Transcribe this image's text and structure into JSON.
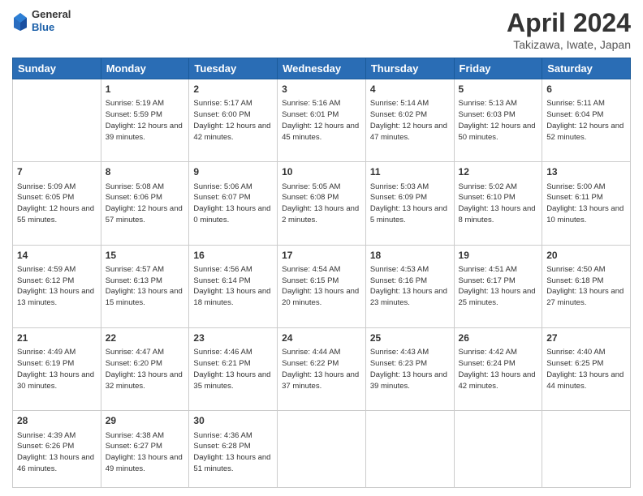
{
  "header": {
    "logo": {
      "line1": "General",
      "line2": "Blue"
    },
    "title": "April 2024",
    "location": "Takizawa, Iwate, Japan"
  },
  "weekdays": [
    "Sunday",
    "Monday",
    "Tuesday",
    "Wednesday",
    "Thursday",
    "Friday",
    "Saturday"
  ],
  "weeks": [
    [
      {
        "day": "",
        "empty": true
      },
      {
        "day": "1",
        "sunrise": "5:19 AM",
        "sunset": "5:59 PM",
        "daylight": "12 hours and 39 minutes."
      },
      {
        "day": "2",
        "sunrise": "5:17 AM",
        "sunset": "6:00 PM",
        "daylight": "12 hours and 42 minutes."
      },
      {
        "day": "3",
        "sunrise": "5:16 AM",
        "sunset": "6:01 PM",
        "daylight": "12 hours and 45 minutes."
      },
      {
        "day": "4",
        "sunrise": "5:14 AM",
        "sunset": "6:02 PM",
        "daylight": "12 hours and 47 minutes."
      },
      {
        "day": "5",
        "sunrise": "5:13 AM",
        "sunset": "6:03 PM",
        "daylight": "12 hours and 50 minutes."
      },
      {
        "day": "6",
        "sunrise": "5:11 AM",
        "sunset": "6:04 PM",
        "daylight": "12 hours and 52 minutes."
      }
    ],
    [
      {
        "day": "7",
        "sunrise": "5:09 AM",
        "sunset": "6:05 PM",
        "daylight": "12 hours and 55 minutes."
      },
      {
        "day": "8",
        "sunrise": "5:08 AM",
        "sunset": "6:06 PM",
        "daylight": "12 hours and 57 minutes."
      },
      {
        "day": "9",
        "sunrise": "5:06 AM",
        "sunset": "6:07 PM",
        "daylight": "13 hours and 0 minutes."
      },
      {
        "day": "10",
        "sunrise": "5:05 AM",
        "sunset": "6:08 PM",
        "daylight": "13 hours and 2 minutes."
      },
      {
        "day": "11",
        "sunrise": "5:03 AM",
        "sunset": "6:09 PM",
        "daylight": "13 hours and 5 minutes."
      },
      {
        "day": "12",
        "sunrise": "5:02 AM",
        "sunset": "6:10 PM",
        "daylight": "13 hours and 8 minutes."
      },
      {
        "day": "13",
        "sunrise": "5:00 AM",
        "sunset": "6:11 PM",
        "daylight": "13 hours and 10 minutes."
      }
    ],
    [
      {
        "day": "14",
        "sunrise": "4:59 AM",
        "sunset": "6:12 PM",
        "daylight": "13 hours and 13 minutes."
      },
      {
        "day": "15",
        "sunrise": "4:57 AM",
        "sunset": "6:13 PM",
        "daylight": "13 hours and 15 minutes."
      },
      {
        "day": "16",
        "sunrise": "4:56 AM",
        "sunset": "6:14 PM",
        "daylight": "13 hours and 18 minutes."
      },
      {
        "day": "17",
        "sunrise": "4:54 AM",
        "sunset": "6:15 PM",
        "daylight": "13 hours and 20 minutes."
      },
      {
        "day": "18",
        "sunrise": "4:53 AM",
        "sunset": "6:16 PM",
        "daylight": "13 hours and 23 minutes."
      },
      {
        "day": "19",
        "sunrise": "4:51 AM",
        "sunset": "6:17 PM",
        "daylight": "13 hours and 25 minutes."
      },
      {
        "day": "20",
        "sunrise": "4:50 AM",
        "sunset": "6:18 PM",
        "daylight": "13 hours and 27 minutes."
      }
    ],
    [
      {
        "day": "21",
        "sunrise": "4:49 AM",
        "sunset": "6:19 PM",
        "daylight": "13 hours and 30 minutes."
      },
      {
        "day": "22",
        "sunrise": "4:47 AM",
        "sunset": "6:20 PM",
        "daylight": "13 hours and 32 minutes."
      },
      {
        "day": "23",
        "sunrise": "4:46 AM",
        "sunset": "6:21 PM",
        "daylight": "13 hours and 35 minutes."
      },
      {
        "day": "24",
        "sunrise": "4:44 AM",
        "sunset": "6:22 PM",
        "daylight": "13 hours and 37 minutes."
      },
      {
        "day": "25",
        "sunrise": "4:43 AM",
        "sunset": "6:23 PM",
        "daylight": "13 hours and 39 minutes."
      },
      {
        "day": "26",
        "sunrise": "4:42 AM",
        "sunset": "6:24 PM",
        "daylight": "13 hours and 42 minutes."
      },
      {
        "day": "27",
        "sunrise": "4:40 AM",
        "sunset": "6:25 PM",
        "daylight": "13 hours and 44 minutes."
      }
    ],
    [
      {
        "day": "28",
        "sunrise": "4:39 AM",
        "sunset": "6:26 PM",
        "daylight": "13 hours and 46 minutes."
      },
      {
        "day": "29",
        "sunrise": "4:38 AM",
        "sunset": "6:27 PM",
        "daylight": "13 hours and 49 minutes."
      },
      {
        "day": "30",
        "sunrise": "4:36 AM",
        "sunset": "6:28 PM",
        "daylight": "13 hours and 51 minutes."
      },
      {
        "day": "",
        "empty": true
      },
      {
        "day": "",
        "empty": true
      },
      {
        "day": "",
        "empty": true
      },
      {
        "day": "",
        "empty": true
      }
    ]
  ]
}
